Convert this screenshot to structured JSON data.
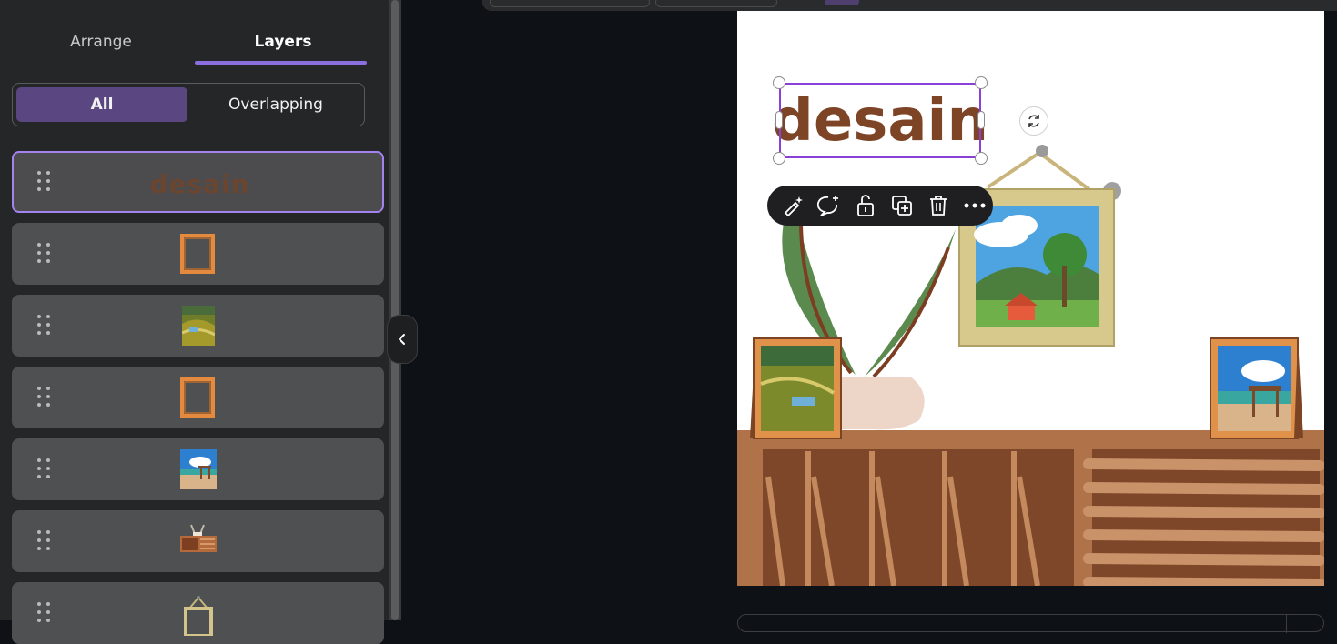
{
  "panel": {
    "tabs": [
      {
        "label": "Arrange"
      },
      {
        "label": "Layers"
      }
    ],
    "filter": {
      "all_label": "All",
      "overlapping_label": "Overlapping"
    },
    "layers": [
      {
        "type": "text",
        "text": "desain",
        "selected": true
      },
      {
        "type": "frame-orange"
      },
      {
        "type": "photo-field"
      },
      {
        "type": "frame-orange"
      },
      {
        "type": "photo-beach"
      },
      {
        "type": "cabinet"
      },
      {
        "type": "frame-hanging"
      }
    ]
  },
  "canvas": {
    "title_text": "desain",
    "context_toolbar": [
      {
        "icon": "magic-edit-icon"
      },
      {
        "icon": "comment-add-icon"
      },
      {
        "icon": "unlock-icon"
      },
      {
        "icon": "duplicate-icon"
      },
      {
        "icon": "delete-icon"
      },
      {
        "icon": "more-icon"
      }
    ]
  },
  "colors": {
    "accent": "#8b6fe0",
    "selection": "#8b3fd9",
    "text_brown": "#7d4526",
    "wood": "#b07248"
  }
}
